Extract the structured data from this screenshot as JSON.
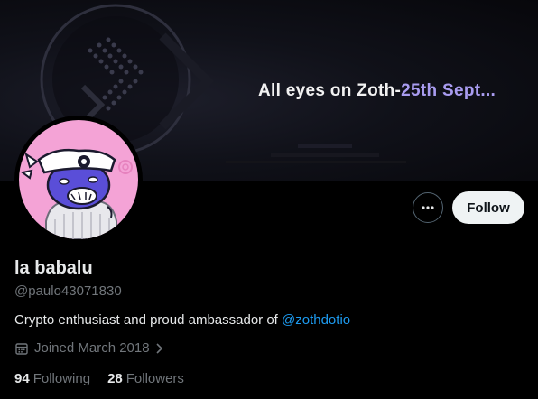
{
  "banner": {
    "text_part1": "All eyes on Zoth-",
    "text_part2": "25th Sept..."
  },
  "profile": {
    "name": "la babalu",
    "handle": "@paulo43071830",
    "bio_text": "Crypto enthusiast and proud ambassador of ",
    "bio_mention": "@zothdotio",
    "joined": "Joined March 2018",
    "following_count": "94",
    "following_label": "Following",
    "followers_count": "28",
    "followers_label": "Followers"
  },
  "actions": {
    "more_icon": "more-horizontal-icon",
    "follow_label": "Follow"
  },
  "colors": {
    "accent_link": "#1d9bf0",
    "banner_highlight": "#a99cf0",
    "avatar_bg": "#f4a3d6"
  }
}
